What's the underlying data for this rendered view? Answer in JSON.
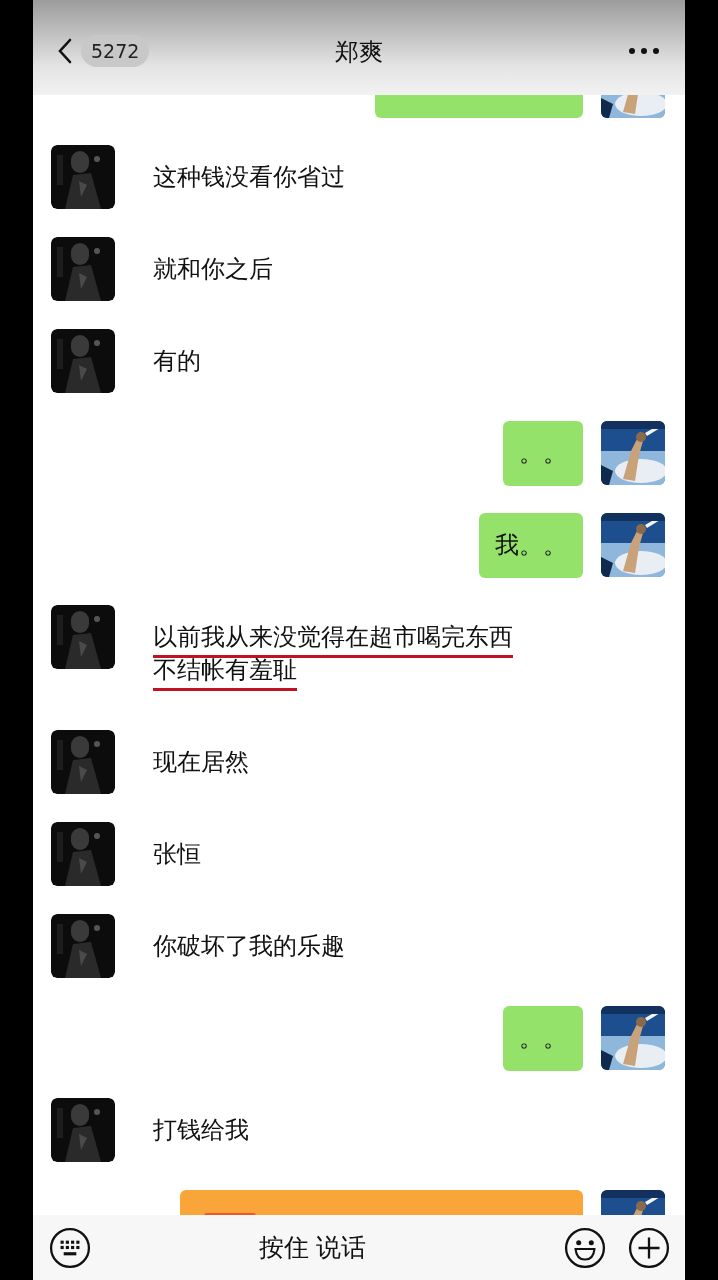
{
  "header": {
    "unread_count": "5272",
    "title": "郑爽"
  },
  "messages": [
    {
      "outgoing": true,
      "kind": "cut"
    },
    {
      "outgoing": false,
      "kind": "text",
      "lines": [
        "这种钱没看你省过"
      ],
      "underlined": false
    },
    {
      "outgoing": false,
      "kind": "text",
      "lines": [
        "就和你之后"
      ],
      "underlined": false
    },
    {
      "outgoing": false,
      "kind": "text",
      "lines": [
        "有的"
      ],
      "underlined": false
    },
    {
      "outgoing": true,
      "kind": "text",
      "lines": [
        "。。"
      ],
      "underlined": false
    },
    {
      "outgoing": true,
      "kind": "text",
      "lines": [
        "我。。"
      ],
      "underlined": false
    },
    {
      "outgoing": false,
      "kind": "text",
      "lines": [
        "以前我从来没觉得在超市喝完东西",
        "不结帐有羞耻"
      ],
      "underlined": true
    },
    {
      "outgoing": false,
      "kind": "text",
      "lines": [
        "现在居然"
      ],
      "underlined": false
    },
    {
      "outgoing": false,
      "kind": "text",
      "lines": [
        "张恒"
      ],
      "underlined": false
    },
    {
      "outgoing": false,
      "kind": "text",
      "lines": [
        "你破坏了我的乐趣"
      ],
      "underlined": false
    },
    {
      "outgoing": true,
      "kind": "text",
      "lines": [
        "。。"
      ],
      "underlined": false
    },
    {
      "outgoing": false,
      "kind": "text",
      "lines": [
        "打钱给我"
      ],
      "underlined": false
    },
    {
      "outgoing": true,
      "kind": "card"
    }
  ],
  "input_bar": {
    "hold_to_talk": "按住 说话"
  }
}
